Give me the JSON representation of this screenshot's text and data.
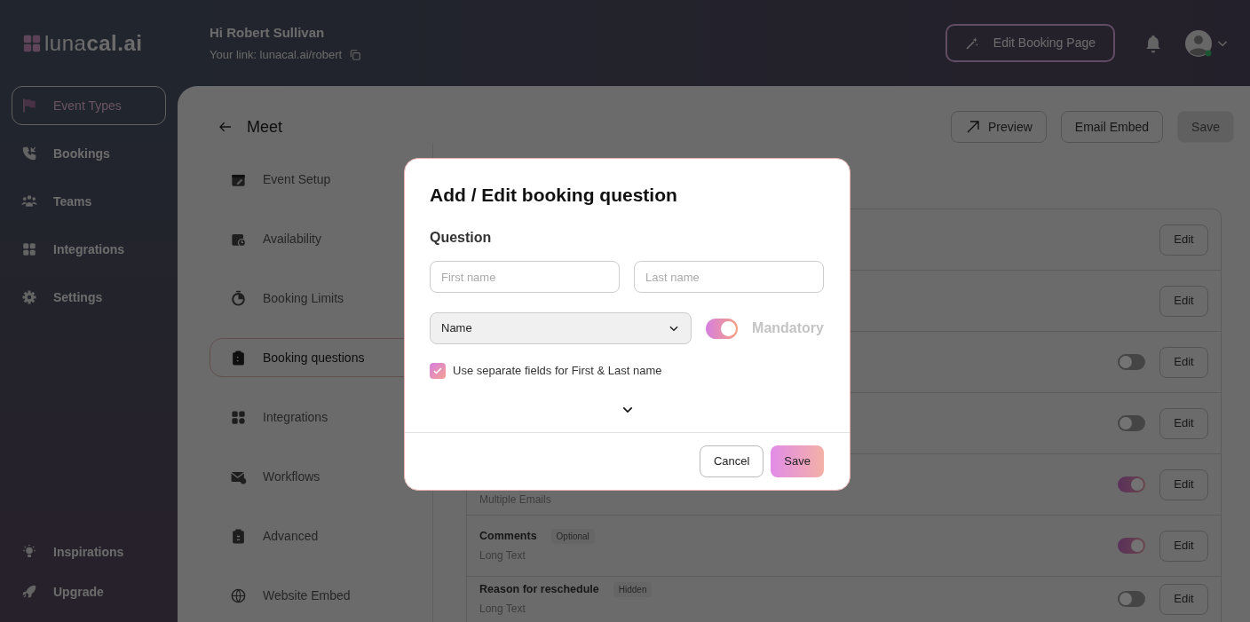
{
  "header": {
    "logo": "luna**cal.ai**",
    "greeting": "Hi Robert Sullivan",
    "link": "Your link: lunacal.ai/robert",
    "edit_button": "Edit Booking Page"
  },
  "sidebar": {
    "items": [
      {
        "label": "Event Types",
        "selected": true
      },
      {
        "label": "Bookings",
        "selected": false
      },
      {
        "label": "Teams",
        "selected": false
      },
      {
        "label": "Integrations",
        "selected": false
      },
      {
        "label": "Settings",
        "selected": false
      }
    ],
    "bottom_items": [
      {
        "label": "Inspirations"
      },
      {
        "label": "Upgrade"
      }
    ]
  },
  "page": {
    "title": "Meet",
    "buttons": [
      {
        "label": "Preview",
        "kind": "link"
      },
      {
        "label": "Email Embed",
        "kind": "plain"
      },
      {
        "label": "Save",
        "kind": "primary",
        "disabled": true
      }
    ]
  },
  "nav": [
    {
      "label": "Event Setup",
      "selected": false
    },
    {
      "label": "Availability",
      "selected": false
    },
    {
      "label": "Booking Limits",
      "selected": false
    },
    {
      "label": "Booking questions",
      "selected": true
    },
    {
      "label": "Integrations",
      "selected": false
    },
    {
      "label": "Workflows",
      "selected": false
    },
    {
      "label": "Advanced",
      "selected": false
    },
    {
      "label": "Website Embed",
      "selected": false
    }
  ],
  "questions": [
    {
      "edit": "Edit"
    },
    {
      "edit": "Edit"
    },
    {
      "on": false,
      "edit": "Edit"
    },
    {
      "on": false,
      "edit": "Edit"
    },
    {
      "subtitle": "Multiple Emails",
      "on": true,
      "edit": "Edit"
    },
    {
      "title": "Comments",
      "badge": "Optional",
      "subtitle": "Long Text",
      "on": true,
      "edit": "Edit"
    },
    {
      "title": "Reason for reschedule",
      "badge": "Hidden",
      "subtitle": "Long Text",
      "on": false,
      "edit": "Edit"
    }
  ],
  "modal": {
    "title": "Add / Edit booking question",
    "section": "Question",
    "fields": [
      {
        "placeholder": "First name"
      },
      {
        "placeholder": "Last name"
      }
    ],
    "type_select": {
      "value": "Name"
    },
    "mandatory": {
      "label": "Mandatory",
      "on": true,
      "disabled": true
    },
    "separate_names": {
      "label": "Use separate fields for First & Last name",
      "checked": true
    },
    "buttons": [
      {
        "label": "Cancel",
        "kind": "secondary"
      },
      {
        "label": "Save",
        "kind": "primary"
      }
    ]
  }
}
